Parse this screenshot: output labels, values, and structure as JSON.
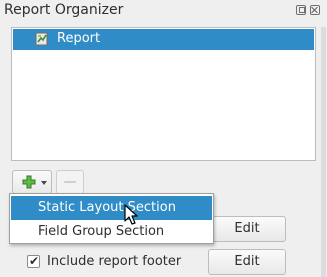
{
  "panel": {
    "title": "Report Organizer"
  },
  "tree": {
    "items": [
      {
        "label": "Report",
        "icon": "report-layout-icon"
      }
    ]
  },
  "toolbar": {
    "add_icon": "plus-icon",
    "remove_icon": "minus-icon"
  },
  "menu": {
    "items": [
      {
        "label": "Static Layout Section"
      },
      {
        "label": "Field Group Section"
      }
    ]
  },
  "footer": {
    "header_edit_label": "Edit",
    "include_footer_label": "Include report footer",
    "include_footer_checked": true,
    "footer_edit_label": "Edit"
  },
  "colors": {
    "selection": "#308cc6",
    "background": "#efefef",
    "plus_green": "#4caf3a"
  }
}
